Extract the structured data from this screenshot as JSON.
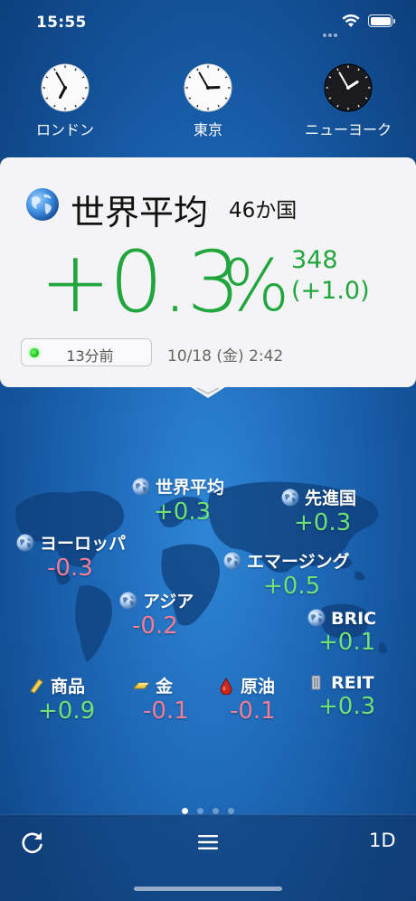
{
  "status_bar": {
    "time": "15:55"
  },
  "clocks": [
    {
      "label": "ロンドン",
      "hour": 6,
      "minute": 55,
      "dark": false
    },
    {
      "label": "東京",
      "hour": 14,
      "minute": 55,
      "dark": false
    },
    {
      "label": "ニューヨーク",
      "hour": 1,
      "minute": 55,
      "dark": true
    }
  ],
  "summary": {
    "title": "世界平均",
    "countries": "46か国",
    "change_pct": "+0.3",
    "pct_sign": "%",
    "points": "348",
    "points_change": "(+1.0)",
    "updated_ago": "13分前",
    "datetime": "10/18 (金) 2:42"
  },
  "regions": [
    {
      "id": "world",
      "name": "世界平均",
      "value": "+0.3",
      "trend": "pos"
    },
    {
      "id": "developed",
      "name": "先進国",
      "value": "+0.3",
      "trend": "pos"
    },
    {
      "id": "europe",
      "name": "ヨーロッパ",
      "value": "-0.3",
      "trend": "neg"
    },
    {
      "id": "emerging",
      "name": "エマージング",
      "value": "+0.5",
      "trend": "pos"
    },
    {
      "id": "asia",
      "name": "アジア",
      "value": "-0.2",
      "trend": "neg"
    },
    {
      "id": "bric",
      "name": "BRIC",
      "value": "+0.1",
      "trend": "pos"
    },
    {
      "id": "commodities",
      "name": "商品",
      "value": "+0.9",
      "trend": "pos",
      "icon": "commodity-icon"
    },
    {
      "id": "gold",
      "name": "金",
      "value": "-0.1",
      "trend": "neg",
      "icon": "gold-bar-icon"
    },
    {
      "id": "oil",
      "name": "原油",
      "value": "-0.1",
      "trend": "neg",
      "icon": "oil-drop-icon"
    },
    {
      "id": "reit",
      "name": "REIT",
      "value": "+0.3",
      "trend": "pos",
      "icon": "building-icon"
    }
  ],
  "pager": {
    "count": 4,
    "active": 0
  },
  "toolbar": {
    "period_label": "1D"
  },
  "colors": {
    "positive": "#21a63e",
    "positive_on_map": "#6fe07a",
    "negative_on_map": "#f07e98"
  }
}
